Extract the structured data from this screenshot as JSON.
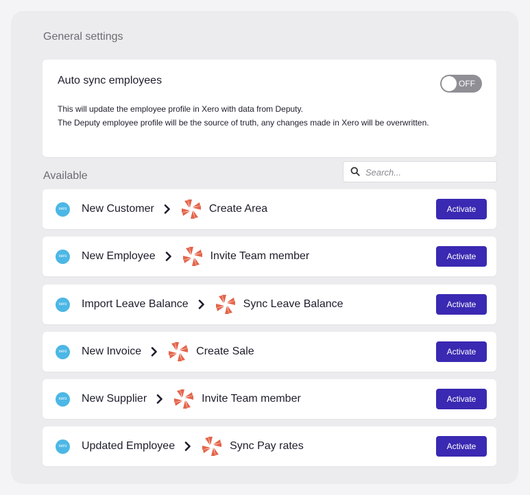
{
  "general_settings": {
    "heading": "General settings",
    "auto_sync": {
      "title": "Auto sync employees",
      "description_line1": "This will update the employee profile in Xero with data from Deputy.",
      "description_line2": "The Deputy employee profile will be the source of truth, any changes made in Xero will be overwritten.",
      "toggle_state": "OFF"
    }
  },
  "available": {
    "heading": "Available",
    "search_placeholder": "Search...",
    "xero_icon_text": "xero",
    "brand_colors": {
      "xero": "#4cb7e6",
      "deputy": "#e4654b",
      "activate_button": "#3a29b2"
    },
    "integrations": [
      {
        "trigger": "New Customer",
        "action": "Create Area",
        "button": "Activate"
      },
      {
        "trigger": "New Employee",
        "action": "Invite Team member",
        "button": "Activate"
      },
      {
        "trigger": "Import Leave Balance",
        "action": "Sync Leave Balance",
        "button": "Activate"
      },
      {
        "trigger": "New Invoice",
        "action": "Create Sale",
        "button": "Activate"
      },
      {
        "trigger": "New Supplier",
        "action": "Invite Team member",
        "button": "Activate"
      },
      {
        "trigger": "Updated Employee",
        "action": "Sync Pay rates",
        "button": "Activate"
      }
    ]
  }
}
